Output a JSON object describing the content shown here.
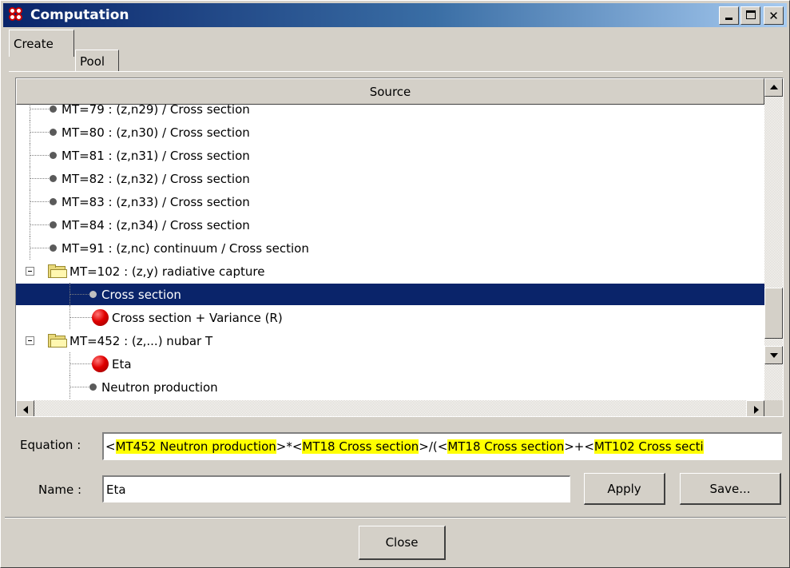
{
  "window": {
    "title": "Computation",
    "minimize_label": "_",
    "close_label": "✕"
  },
  "tabs": [
    {
      "label": "Create",
      "active": true
    },
    {
      "label": "Pool",
      "active": false
    }
  ],
  "tree": {
    "header": "Source",
    "rows": [
      {
        "label": "MT=79 : (z,n29) / Cross section",
        "icon": "leaf-dot-icon"
      },
      {
        "label": "MT=80 : (z,n30) / Cross section",
        "icon": "leaf-dot-icon"
      },
      {
        "label": "MT=81 : (z,n31) / Cross section",
        "icon": "leaf-dot-icon"
      },
      {
        "label": "MT=82 : (z,n32) / Cross section",
        "icon": "leaf-dot-icon"
      },
      {
        "label": "MT=83 : (z,n33) / Cross section",
        "icon": "leaf-dot-icon"
      },
      {
        "label": "MT=84 : (z,n34) / Cross section",
        "icon": "leaf-dot-icon"
      },
      {
        "label": "MT=91 : (z,nc) continuum / Cross section",
        "icon": "leaf-dot-icon"
      },
      {
        "label": "MT=102 : (z,y) radiative capture",
        "icon": "folder-open-icon"
      },
      {
        "label": "Cross section",
        "icon": "leaf-dot-icon",
        "selected": true
      },
      {
        "label": "Cross section + Variance (R)",
        "icon": "red-ball-icon"
      },
      {
        "label": "MT=452 : (z,...) nubar T",
        "icon": "folder-open-icon"
      },
      {
        "label": "Eta",
        "icon": "red-ball-icon"
      },
      {
        "label": "Neutron production",
        "icon": "leaf-dot-icon"
      }
    ]
  },
  "equation": {
    "label": "Equation :",
    "parts": [
      {
        "text": "<",
        "hl": false
      },
      {
        "text": "MT452 Neutron production",
        "hl": true
      },
      {
        "text": ">*<",
        "hl": false
      },
      {
        "text": "MT18 Cross section",
        "hl": true
      },
      {
        "text": ">/(<",
        "hl": false
      },
      {
        "text": "MT18 Cross section",
        "hl": true
      },
      {
        "text": ">+<",
        "hl": false
      },
      {
        "text": "MT102 Cross secti",
        "hl": true
      }
    ]
  },
  "name": {
    "label": "Name :",
    "value": "Eta"
  },
  "buttons": {
    "apply": "Apply",
    "save": "Save...",
    "close": "Close"
  }
}
